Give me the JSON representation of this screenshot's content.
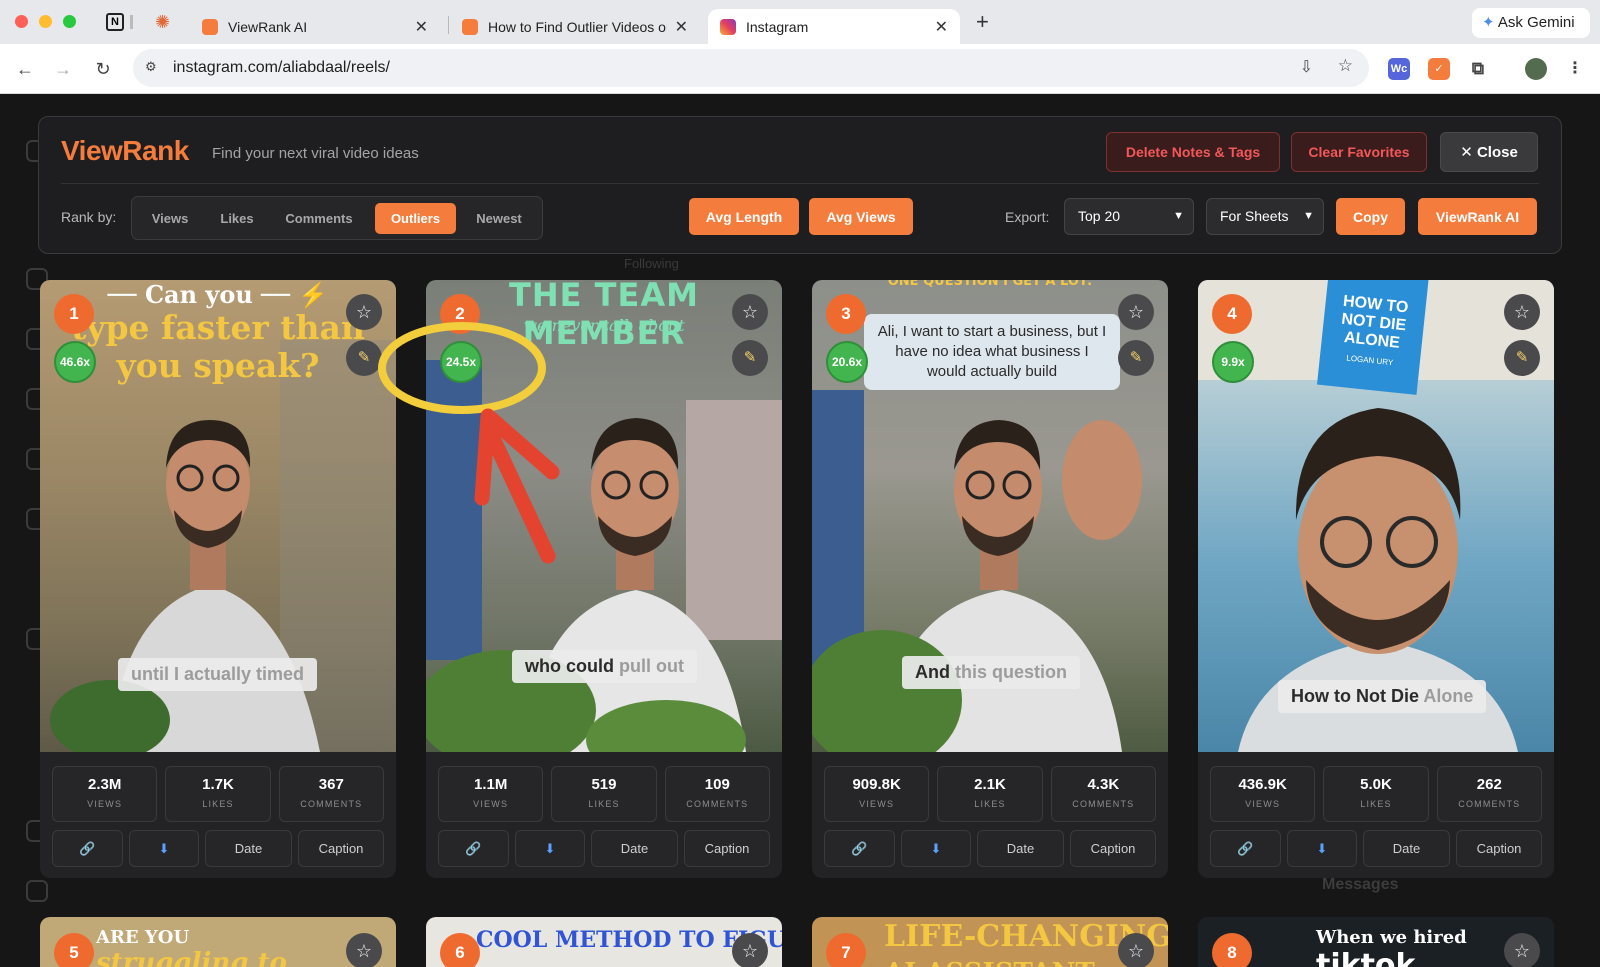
{
  "browser": {
    "tabs": [
      {
        "title": "ViewRank AI"
      },
      {
        "title": "How to Find Outlier Videos on"
      },
      {
        "title": "Instagram"
      }
    ],
    "new_tab": "+",
    "close": "✕",
    "ask_gemini": "Ask Gemini",
    "url": "instagram.com/aliabdaal/reels/",
    "ext_wc": "Wc"
  },
  "viewrank": {
    "brand": "ViewRank",
    "tagline": "Find your next viral video ideas",
    "delete_notes": "Delete Notes & Tags",
    "clear_favorites": "Clear Favorites",
    "close": "✕ Close",
    "rank_by_label": "Rank by:",
    "rank_options": [
      "Views",
      "Likes",
      "Comments",
      "Outliers",
      "Newest"
    ],
    "active_rank": "Outliers",
    "avg_length": "Avg Length",
    "avg_views": "Avg Views",
    "export_label": "Export:",
    "export_scope": "Top 20",
    "export_format": "For Sheets",
    "copy": "Copy",
    "viewrank_ai": "ViewRank AI",
    "colors": {
      "accent": "#f47c3c",
      "outlier_badge": "#43b54e",
      "danger": "#f2585a"
    }
  },
  "stat_labels": {
    "views": "VIEWS",
    "likes": "LIKES",
    "comments": "COMMENTS"
  },
  "action_labels": {
    "date": "Date",
    "caption": "Caption",
    "link_icon": "link-icon",
    "download_icon": "download-icon"
  },
  "cards": [
    {
      "rank": "1",
      "multiplier": "46.6x",
      "hook_line1": "Can you",
      "hook_line2": "type faster than",
      "hook_line3": "you speak?",
      "caption_main": "until I actually timed",
      "caption_dim": "",
      "views": "2.3M",
      "likes": "1.7K",
      "comments": "367"
    },
    {
      "rank": "2",
      "multiplier": "24.5x",
      "hook_line1": "THE TEAM MEMBER",
      "hook_line2": "we never talk about",
      "caption_main": "who could",
      "caption_dim": "pull out",
      "views": "1.1M",
      "likes": "519",
      "comments": "109"
    },
    {
      "rank": "3",
      "multiplier": "20.6x",
      "hook_line1": "ONE QUESTION I GET A LOT:",
      "bubble": "Ali, I want to start a business, but I have no idea what business I would actually build",
      "caption_main": "And",
      "caption_dim": "this question",
      "views": "909.8K",
      "likes": "2.1K",
      "comments": "4.3K"
    },
    {
      "rank": "4",
      "multiplier": "9.9x",
      "book_title": "HOW TO NOT DIE ALONE",
      "book_author": "LOGAN URY",
      "caption_main": "How to Not Die",
      "caption_dim": "Alone",
      "views": "436.9K",
      "likes": "5.0K",
      "comments": "262"
    }
  ],
  "bottom_cards": [
    {
      "rank": "5",
      "title": "ARE YOU",
      "title2": "struggling to"
    },
    {
      "rank": "6",
      "title": "COOL METHOD TO FIGURE OUT"
    },
    {
      "rank": "7",
      "title": "LIFE-CHANGING",
      "title2": "AI ASSISTANT"
    },
    {
      "rank": "8",
      "title": "When we hired",
      "title2": "tiktok"
    }
  ],
  "background": {
    "messages": "Messages",
    "follow": "Following"
  }
}
